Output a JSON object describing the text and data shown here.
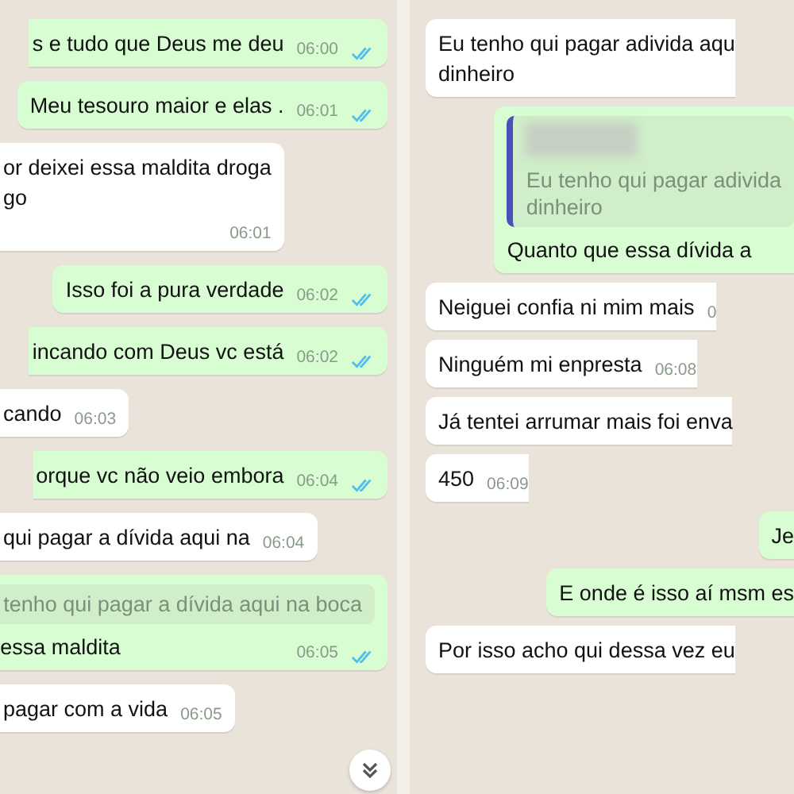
{
  "panels": [
    {
      "scroll_button": true,
      "messages": [
        {
          "kind": "sent",
          "lines": [
            "s e tudo que Deus me deu"
          ],
          "time": "06:00",
          "read": true
        },
        {
          "kind": "sent",
          "lines": [
            "Meu tesouro maior e elas ."
          ],
          "time": "06:01",
          "read": true
        },
        {
          "kind": "received",
          "lines": [
            "or deixei essa maldita droga",
            "go"
          ],
          "time": "06:01"
        },
        {
          "kind": "sent",
          "lines": [
            "Isso foi a pura verdade"
          ],
          "time": "06:02",
          "read": true
        },
        {
          "kind": "sent",
          "lines": [
            "incando com Deus vc está"
          ],
          "time": "06:02",
          "read": true
        },
        {
          "kind": "received",
          "lines": [
            "cando"
          ],
          "time": "06:03"
        },
        {
          "kind": "sent",
          "lines": [
            "orque vc não veio embora"
          ],
          "time": "06:04",
          "read": true
        },
        {
          "kind": "received",
          "lines": [
            "qui pagar a dívida aqui na"
          ],
          "time": "06:04"
        },
        {
          "kind": "sent",
          "quote": {
            "lines": [
              "tenho qui pagar a dívida aqui na boca"
            ]
          },
          "lines": [
            "essa maldita"
          ],
          "time": "06:05",
          "read": true
        },
        {
          "kind": "received",
          "lines": [
            "pagar com a vida"
          ],
          "time": "06:05"
        }
      ]
    },
    {
      "scroll_button": false,
      "messages": [
        {
          "kind": "received",
          "lines": [
            "Eu tenho qui pagar adivida aqu",
            "dinheiro"
          ]
        },
        {
          "kind": "sent",
          "quote": {
            "blurred_name": true,
            "lines": [
              "Eu tenho qui pagar adivida",
              "dinheiro"
            ]
          },
          "lines": [
            "Quanto que essa dívida a"
          ]
        },
        {
          "kind": "received",
          "lines": [
            "Neiguei confia ni mim mais"
          ],
          "time": "0"
        },
        {
          "kind": "received",
          "lines": [
            "Ninguém mi enpresta"
          ],
          "time": "06:08"
        },
        {
          "kind": "received",
          "lines": [
            "Já tentei arrumar mais foi enva"
          ]
        },
        {
          "kind": "received",
          "lines": [
            "450"
          ],
          "time": "06:09"
        },
        {
          "kind": "sent",
          "lines": [
            "Je"
          ]
        },
        {
          "kind": "sent",
          "lines": [
            "E onde é isso aí msm es"
          ]
        },
        {
          "kind": "received",
          "lines": [
            "Por isso acho qui dessa vez eu"
          ]
        }
      ]
    }
  ]
}
